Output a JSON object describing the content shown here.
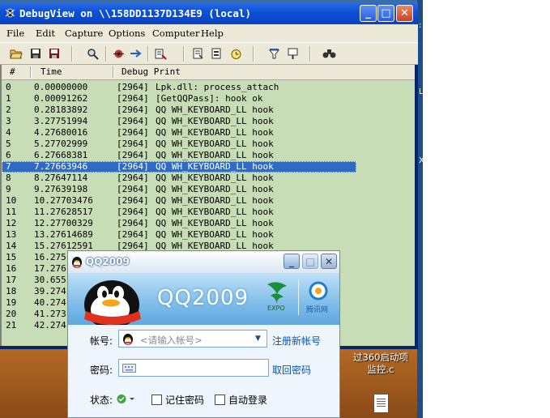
{
  "debugview": {
    "title": "DebugView on \\\\158DD1137D134E9 (local)",
    "window_buttons": {
      "minimize": "_",
      "maximize": "□",
      "close": "✕"
    },
    "menu": [
      "File",
      "Edit",
      "Capture",
      "Options",
      "Computer",
      "Help"
    ],
    "toolbar_icons": [
      "open-icon",
      "save-icon",
      "save-as-icon",
      "find-icon",
      "capture-icon",
      "autoscroll-icon",
      "clear-icon",
      "filter-icon",
      "options-icon",
      "history-icon",
      "highlight-icon",
      "bookmark-icon",
      "binoculars-icon"
    ],
    "columns": {
      "num": "#",
      "time": "Time",
      "debug": "Debug Print"
    },
    "rows": [
      {
        "num": "0",
        "time": "0.00000000",
        "pid": "[2964]",
        "msg": "Lpk.dll: process_attach"
      },
      {
        "num": "1",
        "time": "0.00091262",
        "pid": "[2964]",
        "msg": "[GetQQPass]: hook ok"
      },
      {
        "num": "2",
        "time": "0.28183892",
        "pid": "[2964]",
        "msg": "QQ WH_KEYBOARD_LL hook"
      },
      {
        "num": "3",
        "time": "3.27751994",
        "pid": "[2964]",
        "msg": "QQ WH_KEYBOARD_LL hook"
      },
      {
        "num": "4",
        "time": "4.27680016",
        "pid": "[2964]",
        "msg": "QQ WH_KEYBOARD_LL hook"
      },
      {
        "num": "5",
        "time": "5.27702999",
        "pid": "[2964]",
        "msg": "QQ WH_KEYBOARD_LL hook"
      },
      {
        "num": "6",
        "time": "6.27668381",
        "pid": "[2964]",
        "msg": "QQ WH_KEYBOARD_LL hook"
      },
      {
        "num": "7",
        "time": "7.27663946",
        "pid": "[2964]",
        "msg": "QQ WH_KEYBOARD_LL hook",
        "selected": true
      },
      {
        "num": "8",
        "time": "8.27647114",
        "pid": "[2964]",
        "msg": "QQ WH_KEYBOARD_LL hook"
      },
      {
        "num": "9",
        "time": "9.27639198",
        "pid": "[2964]",
        "msg": "QQ WH_KEYBOARD_LL hook"
      },
      {
        "num": "10",
        "time": "10.27703476",
        "pid": "[2964]",
        "msg": "QQ WH_KEYBOARD_LL hook"
      },
      {
        "num": "11",
        "time": "11.27628517",
        "pid": "[2964]",
        "msg": "QQ WH_KEYBOARD_LL hook"
      },
      {
        "num": "12",
        "time": "12.27700329",
        "pid": "[2964]",
        "msg": "QQ WH_KEYBOARD_LL hook"
      },
      {
        "num": "13",
        "time": "13.27614689",
        "pid": "[2964]",
        "msg": "QQ WH_KEYBOARD_LL hook"
      },
      {
        "num": "14",
        "time": "15.27612591",
        "pid": "[2964]",
        "msg": "QQ WH_KEYBOARD_LL hook"
      },
      {
        "num": "15",
        "time": "16.275",
        "pid": "",
        "msg": ""
      },
      {
        "num": "16",
        "time": "17.276",
        "pid": "",
        "msg": ""
      },
      {
        "num": "17",
        "time": "30.655",
        "pid": "",
        "msg": ""
      },
      {
        "num": "18",
        "time": "39.274",
        "pid": "",
        "msg": ""
      },
      {
        "num": "19",
        "time": "40.274",
        "pid": "",
        "msg": ""
      },
      {
        "num": "20",
        "time": "41.273",
        "pid": "",
        "msg": ""
      },
      {
        "num": "21",
        "time": "42.274",
        "pid": "",
        "msg": ""
      }
    ]
  },
  "qq": {
    "title": "QQ2009",
    "logo_text": "QQ2009",
    "account_label": "帐号:",
    "account_placeholder": "<请输入帐号>",
    "register_link": "注册新帐号",
    "password_label": "密码:",
    "recover_link": "取回密码",
    "status_label": "状态:",
    "remember_password": "记住密码",
    "auto_login": "自动登录",
    "expo_text": "EXPO",
    "tencent_text": "腾讯网"
  },
  "desktop": {
    "icon_label_line1": "过360启动项",
    "icon_label_line2": "监控.c",
    "edge_texts": [
      ":",
      "L",
      "X"
    ]
  },
  "colors": {
    "list_bg": "#c6ddb5",
    "selection": "#316ac5",
    "xp_title": "#0b50d6"
  }
}
